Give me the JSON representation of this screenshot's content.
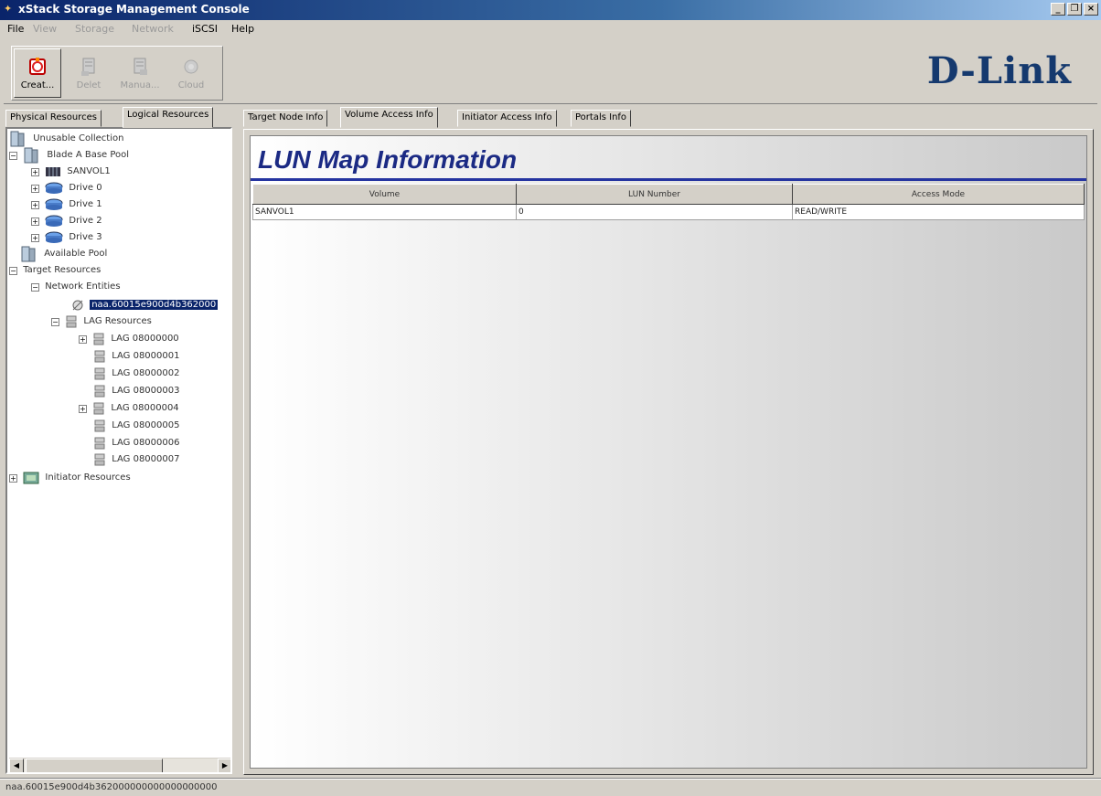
{
  "window": {
    "title": "xStack Storage Management Console"
  },
  "menu": [
    {
      "label": "File",
      "enabled": true
    },
    {
      "label": "View",
      "enabled": false
    },
    {
      "label": "Storage",
      "enabled": false
    },
    {
      "label": "Network",
      "enabled": false
    },
    {
      "label": "iSCSI",
      "enabled": true
    },
    {
      "label": "Help",
      "enabled": true
    }
  ],
  "toolbar": {
    "buttons": [
      {
        "label": "Creat...",
        "icon": "create-icon",
        "enabled": true
      },
      {
        "label": "Delet",
        "icon": "delete-icon",
        "enabled": false
      },
      {
        "label": "Manua...",
        "icon": "manual-icon",
        "enabled": false
      },
      {
        "label": "Cloud",
        "icon": "cloud-icon",
        "enabled": false
      }
    ],
    "logo": "D-Link"
  },
  "left_tabs": [
    "Physical Resources",
    "Logical Resources"
  ],
  "left_tabs_selected": 1,
  "tree": [
    {
      "label": "Unusable Collection"
    },
    {
      "label": "Blade A Base Pool"
    },
    {
      "label": "SANVOL1"
    },
    {
      "label": "Drive 0"
    },
    {
      "label": "Drive 1"
    },
    {
      "label": "Drive 2"
    },
    {
      "label": "Drive 3"
    },
    {
      "label": "Available Pool"
    },
    {
      "label": "Target Resources"
    },
    {
      "label": "Network Entities"
    },
    {
      "label": "naa.60015e900d4b362000"
    },
    {
      "label": "LAG Resources"
    },
    {
      "label": "LAG 08000000"
    },
    {
      "label": "LAG 08000001"
    },
    {
      "label": "LAG 08000002"
    },
    {
      "label": "LAG 08000003"
    },
    {
      "label": "LAG 08000004"
    },
    {
      "label": "LAG 08000005"
    },
    {
      "label": "LAG 08000006"
    },
    {
      "label": "LAG 08000007"
    },
    {
      "label": "Initiator Resources"
    }
  ],
  "right_tabs": [
    "Target Node Info",
    "Volume Access Info",
    "Initiator Access Info",
    "Portals Info"
  ],
  "right_tabs_selected": 1,
  "page_title": "LUN Map Information",
  "table": {
    "headers": [
      "Volume",
      "LUN Number",
      "Access Mode"
    ],
    "rows": [
      [
        "SANVOL1",
        "0",
        "READ/WRITE"
      ]
    ]
  },
  "status": "naa.60015e900d4b362000000000000000000",
  "colors": {
    "accent": "#1b2a84",
    "selection": "#0a246a",
    "logo": "#15396e"
  }
}
